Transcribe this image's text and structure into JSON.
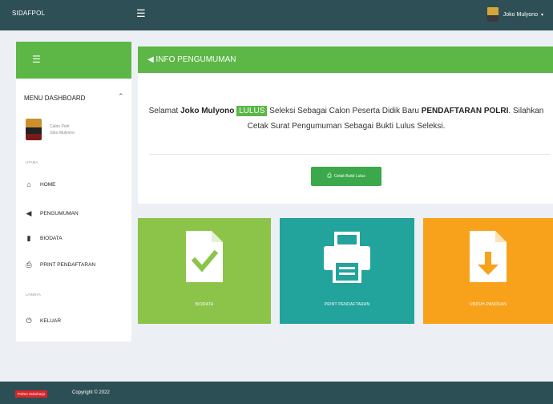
{
  "header": {
    "brand": "SIDAFPOL",
    "menu_icon": "hamburger-icon",
    "user_name": "Joko Mulyono",
    "user_caret": "▾"
  },
  "sidebar": {
    "menu_title": "MENU DASHBOARD",
    "collapse_icon": "chevron-up-icon",
    "profile": {
      "line1": "Calon Polri",
      "line2": "Joko Mulyono"
    },
    "section_main": "UTAMA",
    "section_other": "LAINNYA",
    "items": [
      {
        "label": "HOME",
        "icon": "home-icon"
      },
      {
        "label": "PENGUMUMAN",
        "icon": "megaphone-icon"
      },
      {
        "label": "BIODATA",
        "icon": "file-icon"
      },
      {
        "label": "PRINT PENDAFTARAN",
        "icon": "print-icon"
      },
      {
        "label": "KELUAR",
        "icon": "power-icon"
      }
    ]
  },
  "info": {
    "title": "INFO PENGUMUMAN",
    "title_icon": "megaphone-icon",
    "line1_pre": "Selamat",
    "name": "Joko Mulyono",
    "status": "LULUS",
    "line1_mid": "Seleksi Sebagai Calon Peserta Didik Baru",
    "program": "PENDAFTARAN POLRI",
    "line2": ". Silahkan Cetak Surat Pengumuman Sebagai Bukti Lulus Seleksi.",
    "button_label": "Cetak Bukti Lulus"
  },
  "tiles": [
    {
      "label": "BIODATA",
      "icon": "file-check-icon",
      "color": "#8cc44a"
    },
    {
      "label": "PRINT PENDAFTARAN",
      "icon": "printer-icon",
      "color": "#22a39c"
    },
    {
      "label": "UNDUH PANDUAN",
      "icon": "file-download-icon",
      "color": "#f8a21c"
    }
  ],
  "footer": {
    "badge": "Polres Sukoharjo",
    "copyright": "Copyright © 2022"
  }
}
